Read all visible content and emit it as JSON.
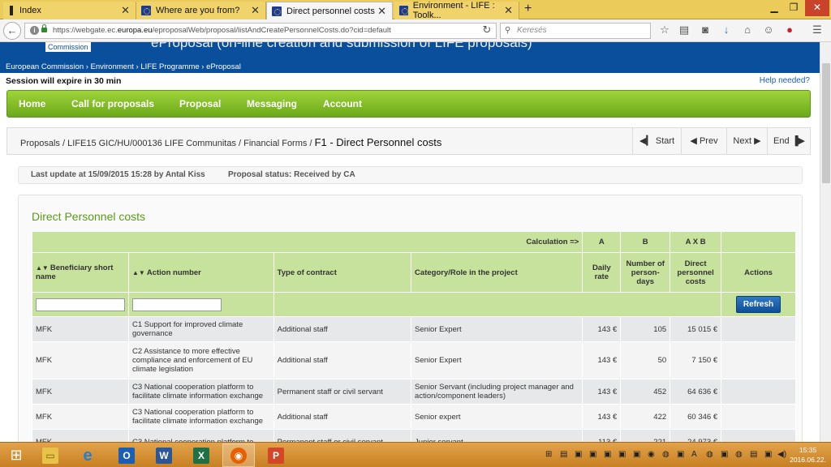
{
  "browser": {
    "tabs": [
      {
        "label": "Index",
        "icon": "index-icon"
      },
      {
        "label": "Where are you from?",
        "icon": "eu-flag-icon"
      },
      {
        "label": "Direct personnel costs",
        "icon": "eu-flag-icon",
        "active": true
      },
      {
        "label": "Environment - LIFE : Toolk...",
        "icon": "eu-flag-icon"
      }
    ],
    "url_prefix": "https://webgate.ec.",
    "url_domain": "europa.eu",
    "url_suffix": "/eproposalWeb/proposal/listAndCreatePersonnelCosts.do?cid=default",
    "search_placeholder": "Keresés"
  },
  "header": {
    "title": "eProposal (on-line creation and submission of LIFE proposals)",
    "commission_label": "Commission",
    "breadcrumb": "European Commission › Environment › LIFE Programme › eProposal"
  },
  "session_text": "Session will expire in 30 min",
  "help_text": "Help needed?",
  "nav": {
    "home": "Home",
    "calls": "Call for proposals",
    "proposal": "Proposal",
    "messaging": "Messaging",
    "account": "Account"
  },
  "crumbs": {
    "c1": "Proposals",
    "c2": "LIFE15 GIC/HU/000136 LIFE Communitas",
    "c3": "Financial Forms",
    "current": "F1 - Direct Personnel costs",
    "sep": " / "
  },
  "pager": {
    "start": "Start",
    "prev": "Prev",
    "next": "Next",
    "end": "End"
  },
  "update": {
    "last_update": "Last update at 15/09/2015 15:28 by Antal Kiss",
    "status": "Proposal status: Received by CA"
  },
  "panel_title": "Direct Personnel costs",
  "table": {
    "calc_label": "Calculation =>",
    "calc_a": "A",
    "calc_b": "B",
    "calc_ab": "A X B",
    "headers": {
      "beneficiary": "Beneficiary short name",
      "action": "Action number",
      "contract": "Type of contract",
      "category": "Category/Role in the project",
      "daily": "Daily rate",
      "days": "Number of person-days",
      "direct": "Direct personnel costs",
      "actions": "Actions"
    },
    "refresh": "Refresh",
    "rows": [
      {
        "ben": "MFK",
        "action": "C1 Support for improved climate governance",
        "contract": "Additional staff",
        "category": "Senior Expert",
        "rate": "143 €",
        "days": "105",
        "cost": "15 015 €"
      },
      {
        "ben": "MFK",
        "action": "C2 Assistance to more effective compliance and enforcement of EU climate legislation",
        "contract": "Additional staff",
        "category": "Senior Expert",
        "rate": "143 €",
        "days": "50",
        "cost": "7 150 €"
      },
      {
        "ben": "MFK",
        "action": "C3 National cooperation platform to facilitate climate information exchange",
        "contract": "Permanent staff or civil servant",
        "category": "Senior Servant (including project manager and action/component leaders)",
        "rate": "143 €",
        "days": "452",
        "cost": "64 636 €"
      },
      {
        "ben": "MFK",
        "action": "C3 National cooperation platform to facilitate climate information exchange",
        "contract": "Additional staff",
        "category": "Senior expert",
        "rate": "143 €",
        "days": "422",
        "cost": "60 346 €"
      },
      {
        "ben": "MFK",
        "action": "C3 National cooperation platform to",
        "contract": "Permanent staff or civil servant",
        "category": "Junior servant",
        "rate": "113 €",
        "days": "221",
        "cost": "24 973 €"
      }
    ]
  },
  "taskbar": {
    "clock_time": "15:35",
    "clock_date": "2016.06.22."
  }
}
